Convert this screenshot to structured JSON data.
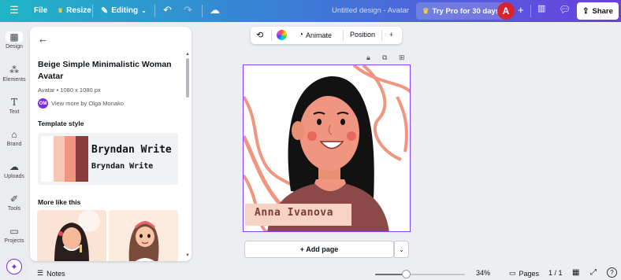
{
  "topbar": {
    "menu_icon": "hamburger-icon",
    "file": "File",
    "resize": "Resize",
    "editing": "Editing",
    "title": "Untitled design - Avatar",
    "try_pro": "Try Pro for 30 days",
    "avatar_letter": "A",
    "share": "Share"
  },
  "rail": {
    "items": [
      {
        "label": "Design"
      },
      {
        "label": "Elements"
      },
      {
        "label": "Text"
      },
      {
        "label": "Brand"
      },
      {
        "label": "Uploads"
      },
      {
        "label": "Tools"
      },
      {
        "label": "Projects"
      }
    ]
  },
  "panel": {
    "title": "Beige Simple Minimalistic Woman Avatar",
    "meta": "Avatar • 1080 x 1080 px",
    "author_initials": "OM",
    "author": "View more by Olga Monako",
    "template_style": "Template style",
    "font_sample_big": "Bryndan Write",
    "font_sample_small": "Bryndan Write",
    "swatches": [
      "#ffffff",
      "#f6c9b5",
      "#f0957f",
      "#e36f5c",
      "#873b3b"
    ],
    "more_like_this": "More like this"
  },
  "floatbar": {
    "animate": "Animate",
    "position": "Position"
  },
  "canvas": {
    "name_text": "Anna Ivanova"
  },
  "addpage": {
    "label": "+ Add page"
  },
  "bottombar": {
    "notes": "Notes",
    "zoom": "34%",
    "zoom_level": 0.34,
    "pages": "Pages",
    "page_count": "1 / 1",
    "help": "?"
  }
}
